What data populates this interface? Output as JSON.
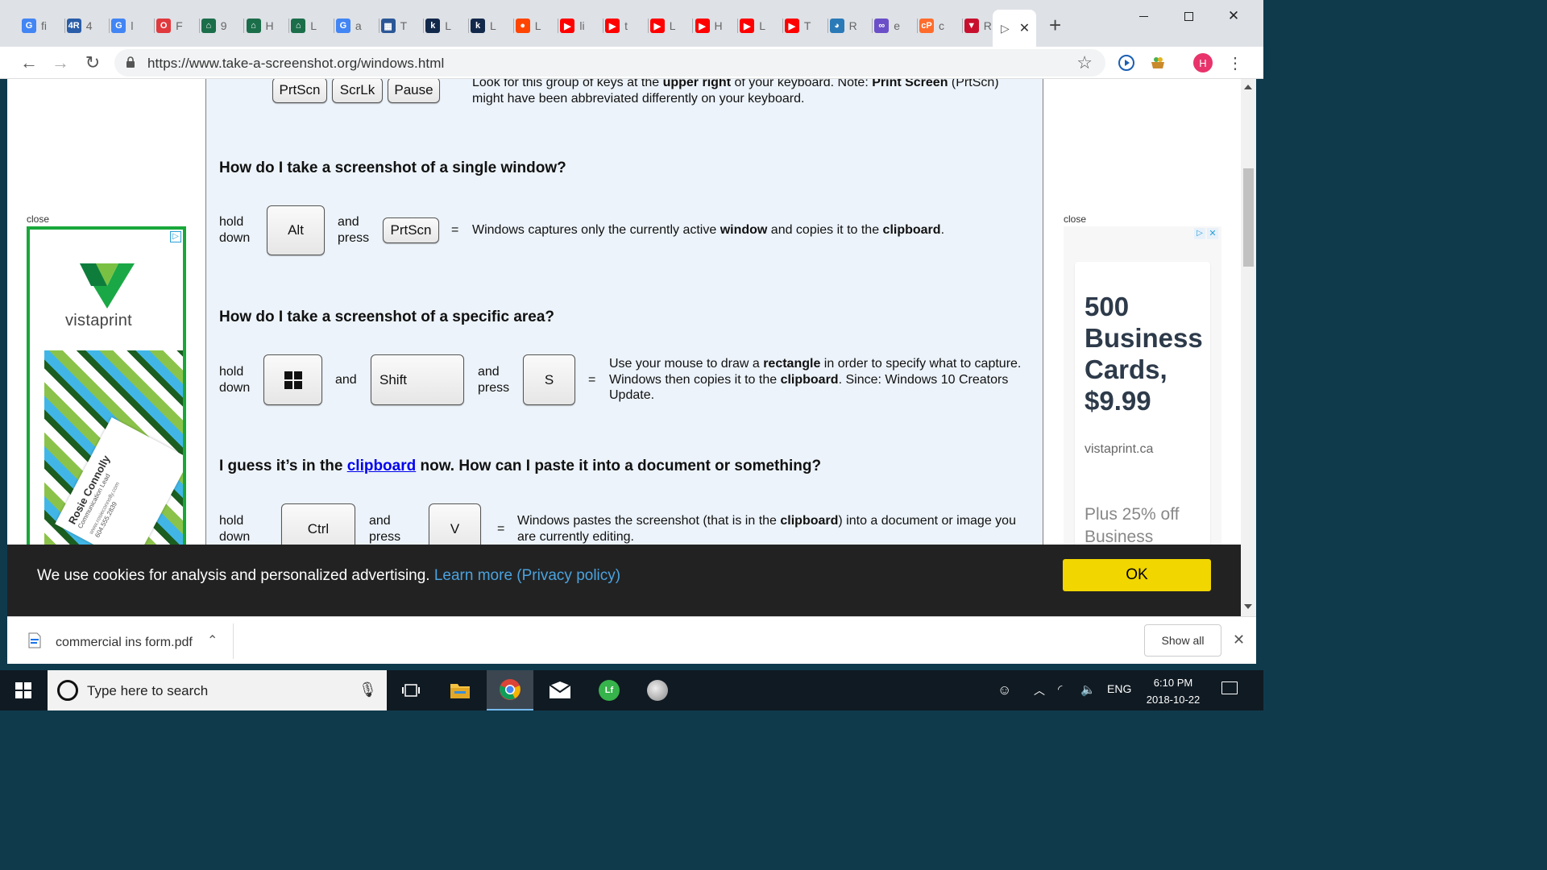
{
  "tabs": [
    {
      "letter": "fi",
      "icon": "google-icon",
      "color": "#4285f4",
      "glyph": "G"
    },
    {
      "letter": "4",
      "icon": "4r-icon",
      "color": "#2a5ea8",
      "glyph": "4R"
    },
    {
      "letter": "l",
      "icon": "google-icon",
      "color": "#4285f4",
      "glyph": "G"
    },
    {
      "letter": "F",
      "icon": "opera-icon",
      "color": "#e0393e",
      "glyph": "O"
    },
    {
      "letter": "9",
      "icon": "library-icon",
      "color": "#1b6e4a",
      "glyph": "⌂"
    },
    {
      "letter": "H",
      "icon": "library-icon",
      "color": "#1b6e4a",
      "glyph": "⌂"
    },
    {
      "letter": "L",
      "icon": "library-icon",
      "color": "#1b6e4a",
      "glyph": "⌂"
    },
    {
      "letter": "a",
      "icon": "google-icon",
      "color": "#4285f4",
      "glyph": "G"
    },
    {
      "letter": "T",
      "icon": "grid-icon",
      "color": "#2b5797",
      "glyph": "▦"
    },
    {
      "letter": "L",
      "icon": "k-icon",
      "color": "#13294b",
      "glyph": "k"
    },
    {
      "letter": "L",
      "icon": "k-icon",
      "color": "#13294b",
      "glyph": "k"
    },
    {
      "letter": "L",
      "icon": "reddit-icon",
      "color": "#ff4500",
      "glyph": "●"
    },
    {
      "letter": "li",
      "icon": "youtube-icon",
      "color": "#ff0000",
      "glyph": "▶"
    },
    {
      "letter": "t",
      "icon": "youtube-icon",
      "color": "#ff0000",
      "glyph": "▶"
    },
    {
      "letter": "L",
      "icon": "youtube-icon",
      "color": "#ff0000",
      "glyph": "▶"
    },
    {
      "letter": "H",
      "icon": "youtube-icon",
      "color": "#ff0000",
      "glyph": "▶"
    },
    {
      "letter": "L",
      "icon": "youtube-icon",
      "color": "#ff0000",
      "glyph": "▶"
    },
    {
      "letter": "T",
      "icon": "youtube-icon",
      "color": "#ff0000",
      "glyph": "▶"
    },
    {
      "letter": "R",
      "icon": "globe-icon",
      "color": "#2a7ab8",
      "glyph": "◕"
    },
    {
      "letter": "e",
      "icon": "infinity-icon",
      "color": "#6a4fc8",
      "glyph": "∞"
    },
    {
      "letter": "c",
      "icon": "cpanel-icon",
      "color": "#ff6c2c",
      "glyph": "cP"
    },
    {
      "letter": "R",
      "icon": "triangle-icon",
      "color": "#c8102e",
      "glyph": "▼"
    }
  ],
  "active_tab": {
    "glyph": "▷"
  },
  "address": {
    "url": "https://www.take-a-screenshot.org/windows.html"
  },
  "profile_initial": "H",
  "page": {
    "top_keys": [
      "PrtScn",
      "ScrLk",
      "Pause"
    ],
    "top_note_1_a": "Look for this group of keys at the ",
    "top_note_1_b": "upper right",
    "top_note_1_c": " of your keyboard. Note: ",
    "top_note_1_d": "Print Screen",
    "top_note_1_e": " (PrtScn)",
    "top_note_2": "might have been abbreviated differently on your keyboard.",
    "q1": "How do I take a screenshot of a single window?",
    "q2": "How do I take a screenshot of a specific area?",
    "q3_a": "I guess it’s in the ",
    "q3_link": "clipboard",
    "q3_b": " now. How can I paste it into a document or something?",
    "hold": "hold",
    "down": "down",
    "and": "and",
    "press": "press",
    "eq": "=",
    "k_alt": "Alt",
    "k_prtscn": "PrtScn",
    "k_shift": "Shift",
    "k_s": "S",
    "k_ctrl": "Ctrl",
    "k_v": "V",
    "d1_a": "Windows captures only the currently active ",
    "d1_b": "window",
    "d1_c": " and copies it to the ",
    "d1_d": "clipboard",
    "d1_e": ".",
    "d2_a": "Use your mouse to draw a ",
    "d2_b": "rectangle",
    "d2_c": " in order to specify what to capture.",
    "d2_d": "Windows then copies it to the ",
    "d2_e": "clipboard",
    "d2_f": ". Since: Windows 10 Creators",
    "d2_g": "Update.",
    "d3_a": "Windows pastes the screenshot (that is in the ",
    "d3_b": "clipboard",
    "d3_c": ") into a document or image you",
    "d3_d": "are currently editing."
  },
  "ads": {
    "close": "close",
    "left_brand": "vistaprint",
    "left_card_name": "Rosie Connolly",
    "left_card_title": "Communication Lead",
    "left_card_url": "www.rosieconnolly.com",
    "left_card_phone": "604.555.2839",
    "right_headline": "500 Business Cards, $9.99",
    "right_domain": "vistaprint.ca",
    "right_sub": "Plus 25% off Business"
  },
  "cookie": {
    "message": "We use cookies for analysis and personalized advertising. ",
    "link": "Learn more (Privacy policy)",
    "ok": "OK"
  },
  "downloads": {
    "file": "commercial ins form.pdf",
    "show_all": "Show all"
  },
  "taskbar": {
    "search_placeholder": "Type here to search",
    "lang": "ENG",
    "time": "6:10 PM",
    "date": "2018-10-22"
  },
  "colors": {
    "tabstrip": "#dee1e6",
    "page_bg": "#ecf3fa",
    "cookie_bg": "#222222",
    "ok_button": "#f1d600",
    "link": "#4aa3df",
    "vistaprint_green": "#18a83a"
  }
}
